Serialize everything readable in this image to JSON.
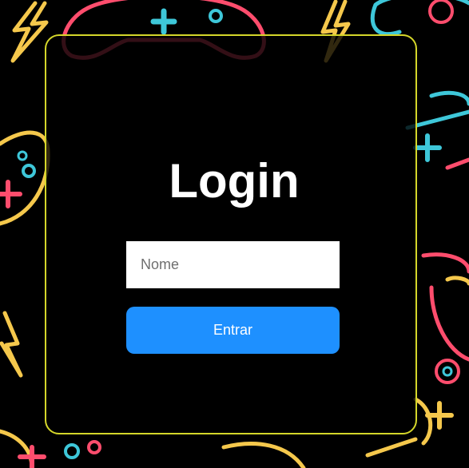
{
  "login": {
    "title": "Login",
    "name_placeholder": "Nome",
    "name_value": "",
    "submit_label": "Entrar"
  },
  "colors": {
    "card_border": "#d4d62a",
    "button_bg": "#1e90ff",
    "pattern_red": "#ff4d6d",
    "pattern_cyan": "#3ec7d9",
    "pattern_yellow": "#f5c84c"
  },
  "background": {
    "pattern_icons": [
      "gamepad-icon",
      "lightning-bolt-icon"
    ]
  }
}
